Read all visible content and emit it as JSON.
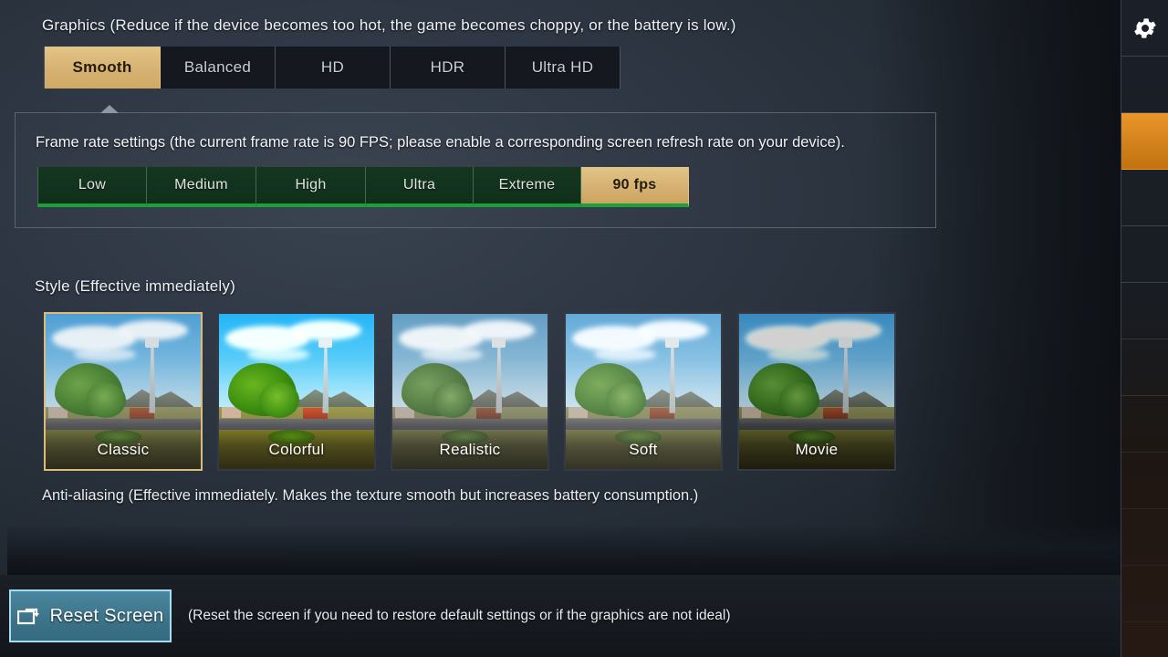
{
  "graphics": {
    "label": "Graphics (Reduce if the device becomes too hot, the game becomes choppy, or the battery is low.)",
    "options": [
      {
        "label": "Smooth",
        "selected": true
      },
      {
        "label": "Balanced",
        "selected": false
      },
      {
        "label": "HD",
        "selected": false
      },
      {
        "label": "HDR",
        "selected": false
      },
      {
        "label": "Ultra HD",
        "selected": false
      }
    ]
  },
  "frame_rate": {
    "label": "Frame rate settings (the current frame rate is 90 FPS; please enable a corresponding screen refresh rate on your device).",
    "current_fps": "90 FPS",
    "options": [
      {
        "label": "Low",
        "selected": false
      },
      {
        "label": "Medium",
        "selected": false
      },
      {
        "label": "High",
        "selected": false
      },
      {
        "label": "Ultra",
        "selected": false
      },
      {
        "label": "Extreme",
        "selected": false
      },
      {
        "label": "90 fps",
        "selected": true
      }
    ]
  },
  "style": {
    "label": "Style (Effective immediately)",
    "options": [
      {
        "label": "Classic",
        "selected": true
      },
      {
        "label": "Colorful",
        "selected": false
      },
      {
        "label": "Realistic",
        "selected": false
      },
      {
        "label": "Soft",
        "selected": false
      },
      {
        "label": "Movie",
        "selected": false
      }
    ]
  },
  "next_section": {
    "label": "Anti-aliasing (Effective immediately. Makes the texture smooth but increases battery consumption.)"
  },
  "bottom_bar": {
    "reset_label": "Reset Screen",
    "reset_icon": "screen-reset-icon",
    "note": "(Reset the screen if you need to restore default settings or if the graphics are not ideal)"
  },
  "sidebar": {
    "items": [
      {
        "icon": "gear-icon",
        "active": false
      },
      {
        "icon": "",
        "active": false
      },
      {
        "icon": "",
        "active": true
      },
      {
        "icon": "",
        "active": false
      },
      {
        "icon": "",
        "active": false
      },
      {
        "icon": "",
        "active": false
      },
      {
        "icon": "",
        "active": false
      },
      {
        "icon": "",
        "active": false
      },
      {
        "icon": "",
        "active": false
      },
      {
        "icon": "",
        "active": false
      },
      {
        "icon": "",
        "active": false
      }
    ]
  },
  "colors": {
    "selected_tan": "#d6b273",
    "fps_green": "#1aa13a",
    "sidebar_active_orange": "#d3811c",
    "reset_blue": "#3d7489",
    "reset_border": "#a5dcee",
    "panel_bg": "#2d3642"
  }
}
